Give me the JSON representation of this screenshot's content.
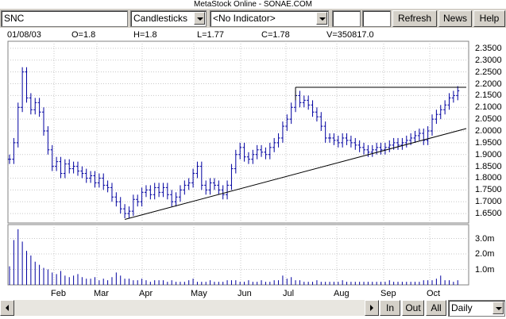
{
  "window": {
    "title": "MetaStock Online - SONAE.COM"
  },
  "toolbar": {
    "symbol_value": "SNC",
    "chart_type": "Candlesticks",
    "indicator": "<No Indicator>",
    "refresh_label": "Refresh",
    "news_label": "News",
    "help_label": "Help"
  },
  "info_bar": {
    "date": "01/08/03",
    "open": "O=1.8",
    "high": "H=1.8",
    "low": "L=1.77",
    "close": "C=1.78",
    "volume": "V=350817.0"
  },
  "footer": {
    "in_label": "In",
    "out_label": "Out",
    "all_label": "All",
    "period": "Daily"
  },
  "chart_data": {
    "type": "candlestick",
    "price_axis": {
      "ticks": [
        "2.3500",
        "2.3000",
        "2.2500",
        "2.2000",
        "2.1500",
        "2.1000",
        "2.0500",
        "2.0000",
        "1.9500",
        "1.9000",
        "1.8500",
        "1.8000",
        "1.7500",
        "1.7000",
        "1.6500"
      ],
      "tick_values": [
        2.35,
        2.3,
        2.25,
        2.2,
        2.15,
        2.1,
        2.05,
        2.0,
        1.95,
        1.9,
        1.85,
        1.8,
        1.75,
        1.7,
        1.65
      ],
      "ylim": [
        1.61,
        2.38
      ]
    },
    "volume_axis": {
      "ticks": [
        "3.0m",
        "2.0m",
        "1.0m"
      ],
      "tick_values": [
        3.0,
        2.0,
        1.0
      ],
      "unit": "m"
    },
    "x_axis": {
      "tick_labels": [
        "Feb",
        "Mar",
        "Apr",
        "May",
        "Jun",
        "Jul",
        "Aug",
        "Sep",
        "Oct"
      ]
    },
    "close_series": [
      [
        0,
        1.88
      ],
      [
        1,
        1.95
      ],
      [
        2,
        2.1
      ],
      [
        3,
        2.25
      ],
      [
        4,
        2.14
      ],
      [
        5,
        2.09
      ],
      [
        6,
        2.12
      ],
      [
        7,
        2.08
      ],
      [
        8,
        2.0
      ],
      [
        9,
        1.92
      ],
      [
        10,
        1.85
      ],
      [
        11,
        1.87
      ],
      [
        12,
        1.82
      ],
      [
        13,
        1.86
      ],
      [
        14,
        1.84
      ],
      [
        15,
        1.85
      ],
      [
        16,
        1.83
      ],
      [
        17,
        1.82
      ],
      [
        18,
        1.8
      ],
      [
        19,
        1.81
      ],
      [
        20,
        1.78
      ],
      [
        21,
        1.8
      ],
      [
        22,
        1.77
      ],
      [
        23,
        1.76
      ],
      [
        24,
        1.72
      ],
      [
        25,
        1.7
      ],
      [
        26,
        1.67
      ],
      [
        27,
        1.65
      ],
      [
        28,
        1.66
      ],
      [
        29,
        1.71
      ],
      [
        30,
        1.7
      ],
      [
        31,
        1.74
      ],
      [
        32,
        1.75
      ],
      [
        33,
        1.73
      ],
      [
        34,
        1.76
      ],
      [
        35,
        1.74
      ],
      [
        36,
        1.76
      ],
      [
        37,
        1.73
      ],
      [
        38,
        1.7
      ],
      [
        39,
        1.72
      ],
      [
        40,
        1.75
      ],
      [
        41,
        1.77
      ],
      [
        42,
        1.78
      ],
      [
        43,
        1.82
      ],
      [
        44,
        1.85
      ],
      [
        45,
        1.77
      ],
      [
        46,
        1.75
      ],
      [
        47,
        1.78
      ],
      [
        48,
        1.77
      ],
      [
        49,
        1.75
      ],
      [
        50,
        1.73
      ],
      [
        51,
        1.77
      ],
      [
        52,
        1.84
      ],
      [
        53,
        1.9
      ],
      [
        54,
        1.93
      ],
      [
        55,
        1.89
      ],
      [
        56,
        1.88
      ],
      [
        57,
        1.9
      ],
      [
        58,
        1.92
      ],
      [
        59,
        1.91
      ],
      [
        60,
        1.9
      ],
      [
        61,
        1.93
      ],
      [
        62,
        1.95
      ],
      [
        63,
        1.97
      ],
      [
        64,
        2.02
      ],
      [
        65,
        2.05
      ],
      [
        66,
        2.1
      ],
      [
        67,
        2.15
      ],
      [
        68,
        2.12
      ],
      [
        69,
        2.13
      ],
      [
        70,
        2.11
      ],
      [
        71,
        2.08
      ],
      [
        72,
        2.06
      ],
      [
        73,
        2.02
      ],
      [
        74,
        1.97
      ],
      [
        75,
        1.97
      ],
      [
        76,
        1.96
      ],
      [
        77,
        1.95
      ],
      [
        78,
        1.97
      ],
      [
        79,
        1.96
      ],
      [
        80,
        1.95
      ],
      [
        81,
        1.94
      ],
      [
        82,
        1.93
      ],
      [
        83,
        1.92
      ],
      [
        84,
        1.91
      ],
      [
        85,
        1.92
      ],
      [
        86,
        1.93
      ],
      [
        87,
        1.92
      ],
      [
        88,
        1.93
      ],
      [
        89,
        1.94
      ],
      [
        90,
        1.95
      ],
      [
        91,
        1.94
      ],
      [
        92,
        1.95
      ],
      [
        93,
        1.96
      ],
      [
        94,
        1.97
      ],
      [
        95,
        1.98
      ],
      [
        96,
        1.99
      ],
      [
        97,
        1.96
      ],
      [
        98,
        2.0
      ],
      [
        99,
        2.05
      ],
      [
        100,
        2.07
      ],
      [
        101,
        2.09
      ],
      [
        102,
        2.11
      ],
      [
        103,
        2.14
      ],
      [
        104,
        2.15
      ],
      [
        105,
        2.17
      ]
    ],
    "volume_m": [
      1.2,
      2.9,
      3.6,
      2.8,
      2.2,
      1.9,
      1.5,
      1.3,
      1.1,
      1.0,
      0.8,
      0.7,
      0.9,
      0.6,
      0.5,
      0.6,
      0.7,
      0.5,
      0.4,
      0.4,
      0.5,
      0.3,
      0.4,
      0.3,
      0.5,
      0.8,
      0.6,
      0.4,
      0.4,
      0.3,
      0.3,
      0.4,
      0.3,
      0.2,
      0.3,
      0.3,
      0.3,
      0.2,
      0.3,
      0.2,
      0.2,
      0.2,
      0.3,
      0.4,
      0.2,
      0.2,
      0.2,
      0.3,
      0.2,
      0.2,
      0.2,
      0.3,
      0.3,
      0.3,
      0.2,
      0.2,
      0.3,
      0.2,
      0.2,
      0.3,
      0.2,
      0.2,
      0.3,
      0.3,
      0.6,
      0.4,
      0.5,
      0.3,
      0.3,
      0.2,
      0.2,
      0.2,
      0.3,
      0.2,
      0.2,
      0.2,
      0.2,
      0.2,
      0.3,
      0.2,
      0.2,
      0.2,
      0.2,
      0.2,
      0.2,
      0.2,
      0.2,
      0.2,
      0.2,
      0.3,
      0.2,
      0.2,
      0.2,
      0.2,
      0.2,
      0.2,
      0.2,
      0.3,
      0.3,
      0.3,
      0.4,
      0.6,
      0.3,
      0.3,
      0.2,
      0.3
    ],
    "trendlines": [
      {
        "from": [
          27,
          1.625
        ],
        "to": [
          107,
          2.01
        ]
      },
      {
        "from": [
          67,
          2.185
        ],
        "to": [
          107,
          2.185
        ]
      }
    ],
    "colors": {
      "price": "#0000a0",
      "volume": "#0000a0",
      "trendline": "#000000",
      "grid": "#c8c8c8"
    }
  }
}
